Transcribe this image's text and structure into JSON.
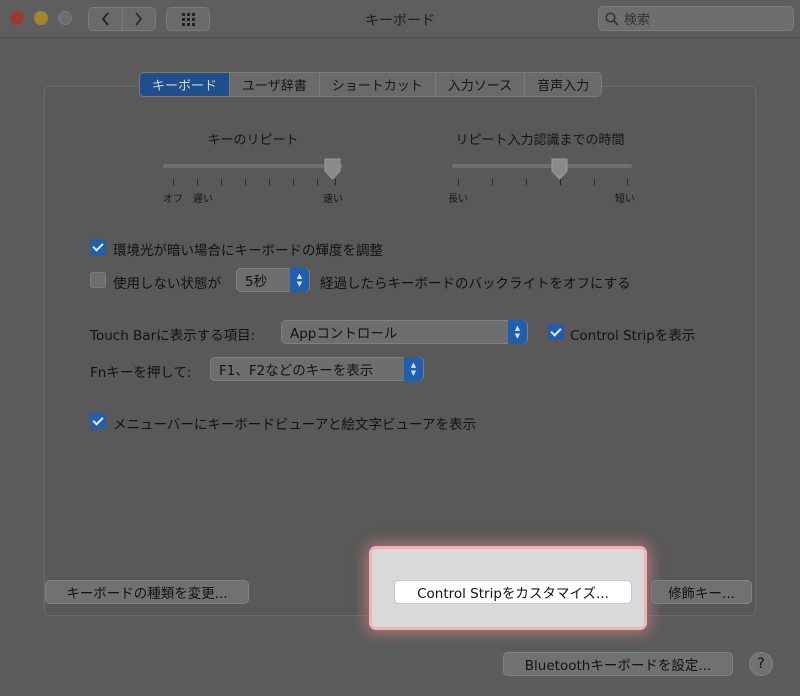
{
  "window": {
    "title": "キーボード"
  },
  "search": {
    "placeholder": "検索"
  },
  "tabs": [
    {
      "label": "キーボード",
      "active": true
    },
    {
      "label": "ユーザ辞書",
      "active": false
    },
    {
      "label": "ショートカット",
      "active": false
    },
    {
      "label": "入力ソース",
      "active": false
    },
    {
      "label": "音声入力",
      "active": false
    }
  ],
  "key_repeat": {
    "label": "キーのリピート",
    "labels": {
      "off": "オフ",
      "slow": "遅い",
      "fast": "速い"
    },
    "level": 1.0
  },
  "repeat_delay": {
    "label": "リピート入力認識までの時間",
    "labels": {
      "long": "長い",
      "short": "短い"
    },
    "level": 0.6
  },
  "options": {
    "adjust_brightness": {
      "label": "環境光が暗い場合にキーボードの輝度を調整",
      "checked": true
    },
    "backlight_off": {
      "label_before": "使用しない状態が",
      "value": "5秒",
      "label_after": "経過したらキーボードのバックライトをオフにする",
      "checked": false
    },
    "touchbar": {
      "label": "Touch Barに表示する項目:",
      "value": "Appコントロール"
    },
    "control_strip": {
      "label": "Control Stripを表示",
      "checked": true
    },
    "fn_key": {
      "label": "Fnキーを押して:",
      "value": "F1、F2などのキーを表示"
    },
    "show_viewer": {
      "label": "メニューバーにキーボードビューアと絵文字ビューアを表示",
      "checked": true
    }
  },
  "buttons": {
    "change_type": "キーボードの種類を変更...",
    "customize_strip": "Control Stripをカスタマイズ...",
    "modifier": "修飾キー...",
    "bluetooth": "Bluetoothキーボードを設定...",
    "help": "?"
  },
  "colors": {
    "accent": "#1f5fae",
    "highlight": "#f0b2b2"
  }
}
